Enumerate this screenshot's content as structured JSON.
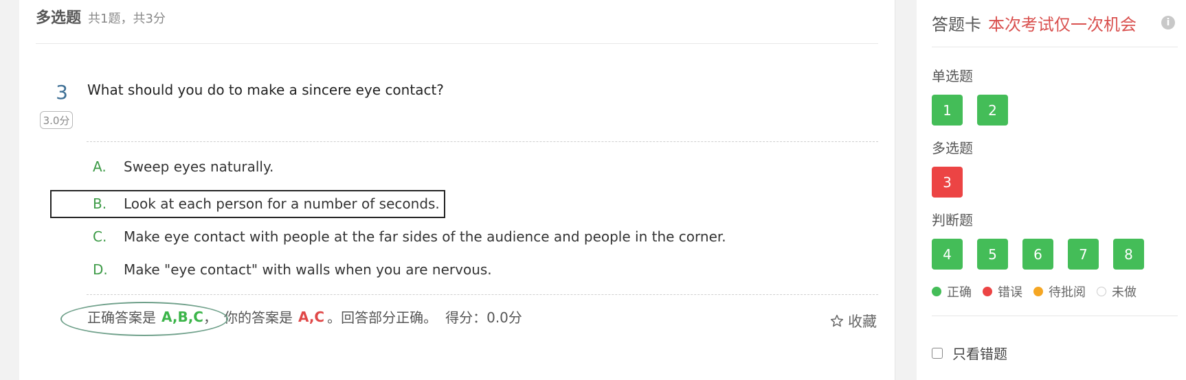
{
  "section": {
    "title": "多选题",
    "meta": "共1题，共3分"
  },
  "question": {
    "number": "3",
    "score": "3.0分",
    "text": "What should you do to make a sincere eye contact?",
    "options": [
      {
        "letter": "A.",
        "text": "Sweep eyes naturally."
      },
      {
        "letter": "B.",
        "text": "Look at each person for a number of seconds."
      },
      {
        "letter": "C.",
        "text": "Make eye contact with people at the far sides of the audience and people in the corner."
      },
      {
        "letter": "D.",
        "text": "Make \"eye contact\" with walls when you are nervous."
      }
    ]
  },
  "result": {
    "correct_label": "正确答案是",
    "correct_value": "A,B,C",
    "separator": "，",
    "your_label": "你的答案是",
    "your_value": "A,C",
    "status": "。回答部分正确。",
    "score_label": "得分：0.0分"
  },
  "favorite": {
    "label": "收藏",
    "icon": "star-outline-icon"
  },
  "sidebar": {
    "title": "答题卡",
    "warning": "本次考试仅一次机会",
    "info_icon": "i",
    "groups": [
      {
        "title": "单选题",
        "items": [
          {
            "label": "1",
            "status": "correct"
          },
          {
            "label": "2",
            "status": "correct"
          }
        ]
      },
      {
        "title": "多选题",
        "items": [
          {
            "label": "3",
            "status": "wrong"
          }
        ]
      },
      {
        "title": "判断题",
        "items": [
          {
            "label": "4",
            "status": "correct"
          },
          {
            "label": "5",
            "status": "correct"
          },
          {
            "label": "6",
            "status": "correct"
          },
          {
            "label": "7",
            "status": "correct"
          },
          {
            "label": "8",
            "status": "correct"
          }
        ]
      }
    ],
    "legend": [
      {
        "label": "正确",
        "color": "#44bd58"
      },
      {
        "label": "错误",
        "color": "#ec4444"
      },
      {
        "label": "待批阅",
        "color": "#f5a623"
      },
      {
        "label": "未做",
        "color": "#ffffff"
      }
    ],
    "only_wrong_label": "只看错题"
  },
  "colors": {
    "correct": "#44bd58",
    "wrong": "#ec4444",
    "pending": "#f5a623",
    "accent_text": "#d9504e"
  }
}
